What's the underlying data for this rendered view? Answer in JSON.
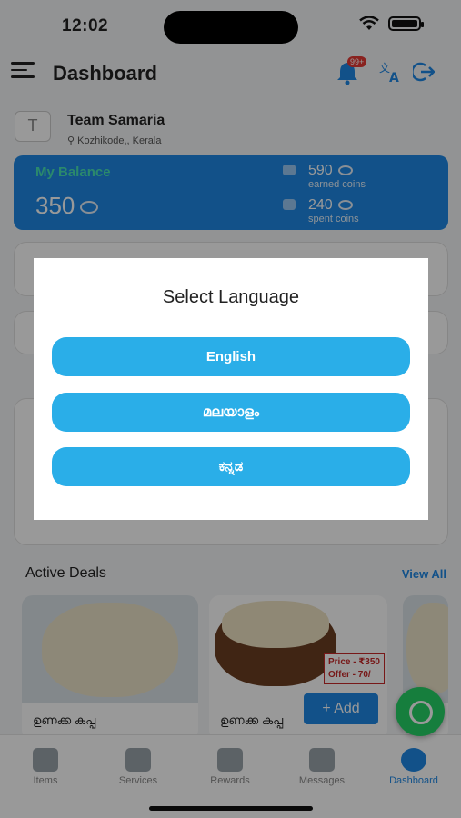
{
  "status": {
    "time": "12:02"
  },
  "header": {
    "title": "Dashboard",
    "notif_badge": "99+"
  },
  "profile": {
    "initial": "T",
    "team": "Team Samaria",
    "location": "Kozhikode,, Kerala"
  },
  "balance": {
    "label": "My Balance",
    "value": "350",
    "earned_value": "590",
    "earned_label": "earned coins",
    "spent_value": "240",
    "spent_label": "spent coins"
  },
  "sections": {
    "active_deals": "Active Deals",
    "view_all": "View All"
  },
  "deals": [
    {
      "name": "ഉണക്ക കപ്പ"
    },
    {
      "name": "ഉണക്ക കപ്പ",
      "price": "Price - ₹350",
      "offer": "Offer - 70/",
      "add_label": "+ Add"
    }
  ],
  "tabs": [
    {
      "label": "Items",
      "icon": "tag-icon"
    },
    {
      "label": "Services",
      "icon": "services-icon"
    },
    {
      "label": "Rewards",
      "icon": "trophy-icon"
    },
    {
      "label": "Messages",
      "icon": "chat-icon"
    },
    {
      "label": "Dashboard",
      "icon": "user-circle-icon",
      "active": true
    }
  ],
  "modal": {
    "title": "Select Language",
    "languages": [
      "English",
      "മലയാളം",
      "ಕನ್ನಡ"
    ]
  },
  "colors": {
    "accent": "#1e88e5",
    "lang_button": "#2aaee8",
    "whatsapp": "#25d366"
  }
}
